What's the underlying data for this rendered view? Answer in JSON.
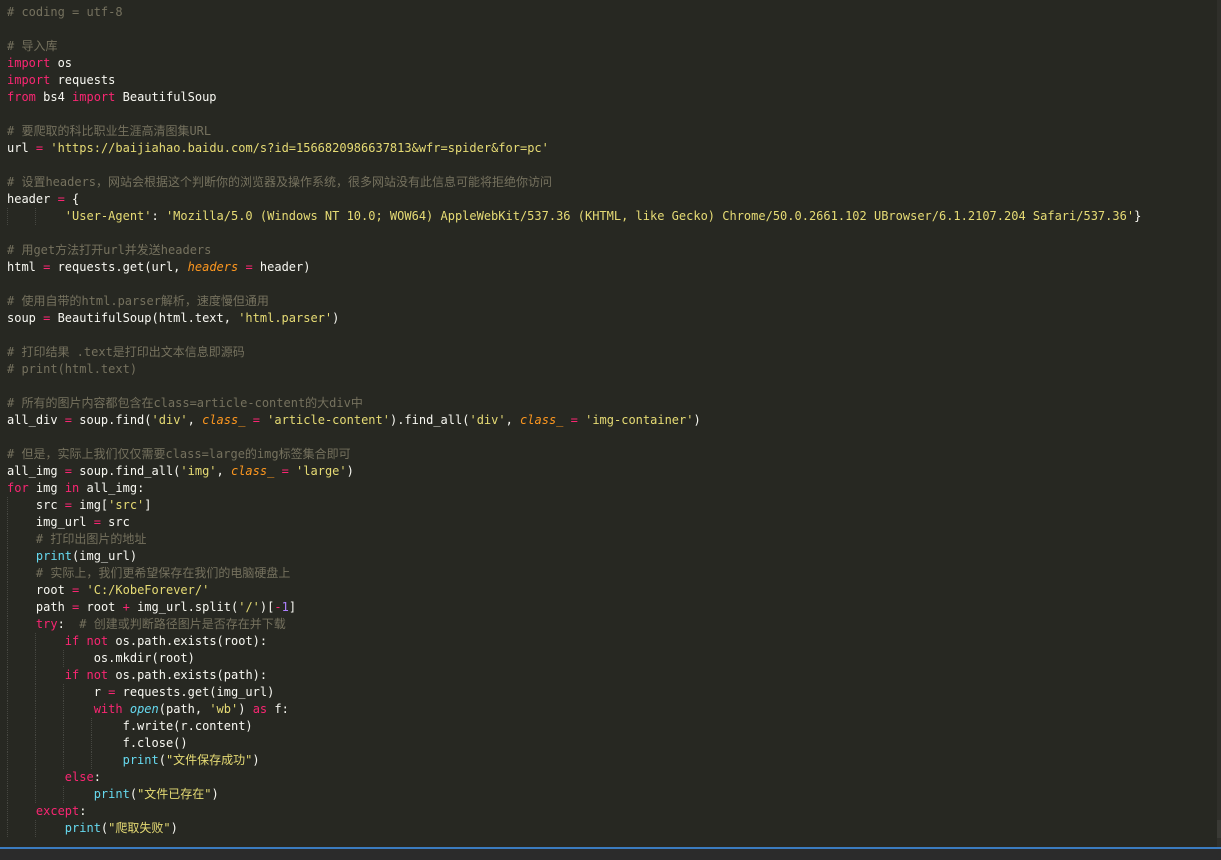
{
  "editor": {
    "language": "python",
    "theme_colors": {
      "background": "#272822",
      "comment": "#75715e",
      "keyword": "#f92672",
      "string": "#e6db74",
      "param": "#fd971f",
      "builtin": "#66d9ef",
      "number": "#ae81ff",
      "text": "#f8f8f2",
      "status_accent": "#3b7cc0"
    },
    "lines": [
      [
        [
          "comment",
          "# coding = utf-8"
        ]
      ],
      [],
      [
        [
          "comment",
          "# 导入库"
        ]
      ],
      [
        [
          "keyword",
          "import"
        ],
        [
          "plain",
          " os"
        ]
      ],
      [
        [
          "keyword",
          "import"
        ],
        [
          "plain",
          " requests"
        ]
      ],
      [
        [
          "keyword",
          "from"
        ],
        [
          "plain",
          " bs4 "
        ],
        [
          "keyword",
          "import"
        ],
        [
          "plain",
          " BeautifulSoup"
        ]
      ],
      [],
      [
        [
          "comment",
          "# 要爬取的科比职业生涯高清图集URL"
        ]
      ],
      [
        [
          "plain",
          "url "
        ],
        [
          "op",
          "="
        ],
        [
          "plain",
          " "
        ],
        [
          "string",
          "'https://baijiahao.baidu.com/s?id=1566820986637813&wfr=spider&for=pc'"
        ]
      ],
      [],
      [
        [
          "comment",
          "# 设置headers，网站会根据这个判断你的浏览器及操作系统，很多网站没有此信息可能将拒绝你访问"
        ]
      ],
      [
        [
          "plain",
          "header "
        ],
        [
          "op",
          "="
        ],
        [
          "plain",
          " {"
        ]
      ],
      [
        [
          "plain",
          "        "
        ],
        [
          "string",
          "'User-Agent'"
        ],
        [
          "plain",
          ": "
        ],
        [
          "string",
          "'Mozilla/5.0 (Windows NT 10.0; WOW64) AppleWebKit/537.36 (KHTML, like Gecko) Chrome/50.0.2661.102 UBrowser/6.1.2107.204 Safari/537.36'"
        ],
        [
          "plain",
          "}"
        ]
      ],
      [],
      [
        [
          "comment",
          "# 用get方法打开url并发送headers"
        ]
      ],
      [
        [
          "plain",
          "html "
        ],
        [
          "op",
          "="
        ],
        [
          "plain",
          " requests.get(url, "
        ],
        [
          "param",
          "headers"
        ],
        [
          "plain",
          " "
        ],
        [
          "op",
          "="
        ],
        [
          "plain",
          " header)"
        ]
      ],
      [],
      [
        [
          "comment",
          "# 使用自带的html.parser解析，速度慢但通用"
        ]
      ],
      [
        [
          "plain",
          "soup "
        ],
        [
          "op",
          "="
        ],
        [
          "plain",
          " BeautifulSoup(html.text, "
        ],
        [
          "string",
          "'html.parser'"
        ],
        [
          "plain",
          ")"
        ]
      ],
      [],
      [
        [
          "comment",
          "# 打印结果 .text是打印出文本信息即源码"
        ]
      ],
      [
        [
          "comment",
          "# print(html.text)"
        ]
      ],
      [],
      [
        [
          "comment",
          "# 所有的图片内容都包含在class=article-content的大div中"
        ]
      ],
      [
        [
          "plain",
          "all_div "
        ],
        [
          "op",
          "="
        ],
        [
          "plain",
          " soup.find("
        ],
        [
          "string",
          "'div'"
        ],
        [
          "plain",
          ", "
        ],
        [
          "param",
          "class_"
        ],
        [
          "plain",
          " "
        ],
        [
          "op",
          "="
        ],
        [
          "plain",
          " "
        ],
        [
          "string",
          "'article-content'"
        ],
        [
          "plain",
          ").find_all("
        ],
        [
          "string",
          "'div'"
        ],
        [
          "plain",
          ", "
        ],
        [
          "param",
          "class_"
        ],
        [
          "plain",
          " "
        ],
        [
          "op",
          "="
        ],
        [
          "plain",
          " "
        ],
        [
          "string",
          "'img-container'"
        ],
        [
          "plain",
          ")"
        ]
      ],
      [],
      [
        [
          "comment",
          "# 但是，实际上我们仅仅需要class=large的img标签集合即可"
        ]
      ],
      [
        [
          "plain",
          "all_img "
        ],
        [
          "op",
          "="
        ],
        [
          "plain",
          " soup.find_all("
        ],
        [
          "string",
          "'img'"
        ],
        [
          "plain",
          ", "
        ],
        [
          "param",
          "class_"
        ],
        [
          "plain",
          " "
        ],
        [
          "op",
          "="
        ],
        [
          "plain",
          " "
        ],
        [
          "string",
          "'large'"
        ],
        [
          "plain",
          ")"
        ]
      ],
      [
        [
          "keyword",
          "for"
        ],
        [
          "plain",
          " img "
        ],
        [
          "keyword",
          "in"
        ],
        [
          "plain",
          " all_img:"
        ]
      ],
      [
        [
          "plain",
          "    src "
        ],
        [
          "op",
          "="
        ],
        [
          "plain",
          " img["
        ],
        [
          "string",
          "'src'"
        ],
        [
          "plain",
          "]"
        ]
      ],
      [
        [
          "plain",
          "    img_url "
        ],
        [
          "op",
          "="
        ],
        [
          "plain",
          " src"
        ]
      ],
      [
        [
          "plain",
          "    "
        ],
        [
          "comment",
          "# 打印出图片的地址"
        ]
      ],
      [
        [
          "plain",
          "    "
        ],
        [
          "builtin",
          "print"
        ],
        [
          "plain",
          "(img_url)"
        ]
      ],
      [
        [
          "plain",
          "    "
        ],
        [
          "comment",
          "# 实际上，我们更希望保存在我们的电脑硬盘上"
        ]
      ],
      [
        [
          "plain",
          "    root "
        ],
        [
          "op",
          "="
        ],
        [
          "plain",
          " "
        ],
        [
          "string",
          "'C:/KobeForever/'"
        ]
      ],
      [
        [
          "plain",
          "    path "
        ],
        [
          "op",
          "="
        ],
        [
          "plain",
          " root "
        ],
        [
          "op",
          "+"
        ],
        [
          "plain",
          " img_url.split("
        ],
        [
          "string",
          "'/'"
        ],
        [
          "plain",
          ")["
        ],
        [
          "op",
          "-"
        ],
        [
          "number",
          "1"
        ],
        [
          "plain",
          "]"
        ]
      ],
      [
        [
          "plain",
          "    "
        ],
        [
          "keyword",
          "try"
        ],
        [
          "plain",
          ":  "
        ],
        [
          "comment",
          "# 创建或判断路径图片是否存在并下载"
        ]
      ],
      [
        [
          "plain",
          "        "
        ],
        [
          "keyword",
          "if"
        ],
        [
          "plain",
          " "
        ],
        [
          "keyword",
          "not"
        ],
        [
          "plain",
          " os.path.exists(root):"
        ]
      ],
      [
        [
          "plain",
          "            os.mkdir(root)"
        ]
      ],
      [
        [
          "plain",
          "        "
        ],
        [
          "keyword",
          "if"
        ],
        [
          "plain",
          " "
        ],
        [
          "keyword",
          "not"
        ],
        [
          "plain",
          " os.path.exists(path):"
        ]
      ],
      [
        [
          "plain",
          "            r "
        ],
        [
          "op",
          "="
        ],
        [
          "plain",
          " requests.get(img_url)"
        ]
      ],
      [
        [
          "plain",
          "            "
        ],
        [
          "keyword",
          "with"
        ],
        [
          "plain",
          " "
        ],
        [
          "builtin-italic",
          "open"
        ],
        [
          "plain",
          "(path, "
        ],
        [
          "string",
          "'wb'"
        ],
        [
          "plain",
          ") "
        ],
        [
          "keyword",
          "as"
        ],
        [
          "plain",
          " f:"
        ]
      ],
      [
        [
          "plain",
          "                f.write(r.content)"
        ]
      ],
      [
        [
          "plain",
          "                f.close()"
        ]
      ],
      [
        [
          "plain",
          "                "
        ],
        [
          "builtin",
          "print"
        ],
        [
          "plain",
          "("
        ],
        [
          "string",
          "\"文件保存成功\""
        ],
        [
          "plain",
          ")"
        ]
      ],
      [
        [
          "plain",
          "        "
        ],
        [
          "keyword",
          "else"
        ],
        [
          "plain",
          ":"
        ]
      ],
      [
        [
          "plain",
          "            "
        ],
        [
          "builtin",
          "print"
        ],
        [
          "plain",
          "("
        ],
        [
          "string",
          "\"文件已存在\""
        ],
        [
          "plain",
          ")"
        ]
      ],
      [
        [
          "plain",
          "    "
        ],
        [
          "keyword",
          "except"
        ],
        [
          "plain",
          ":"
        ]
      ],
      [
        [
          "plain",
          "        "
        ],
        [
          "builtin",
          "print"
        ],
        [
          "plain",
          "("
        ],
        [
          "string",
          "\"爬取失败\""
        ],
        [
          "plain",
          ")"
        ]
      ]
    ]
  }
}
